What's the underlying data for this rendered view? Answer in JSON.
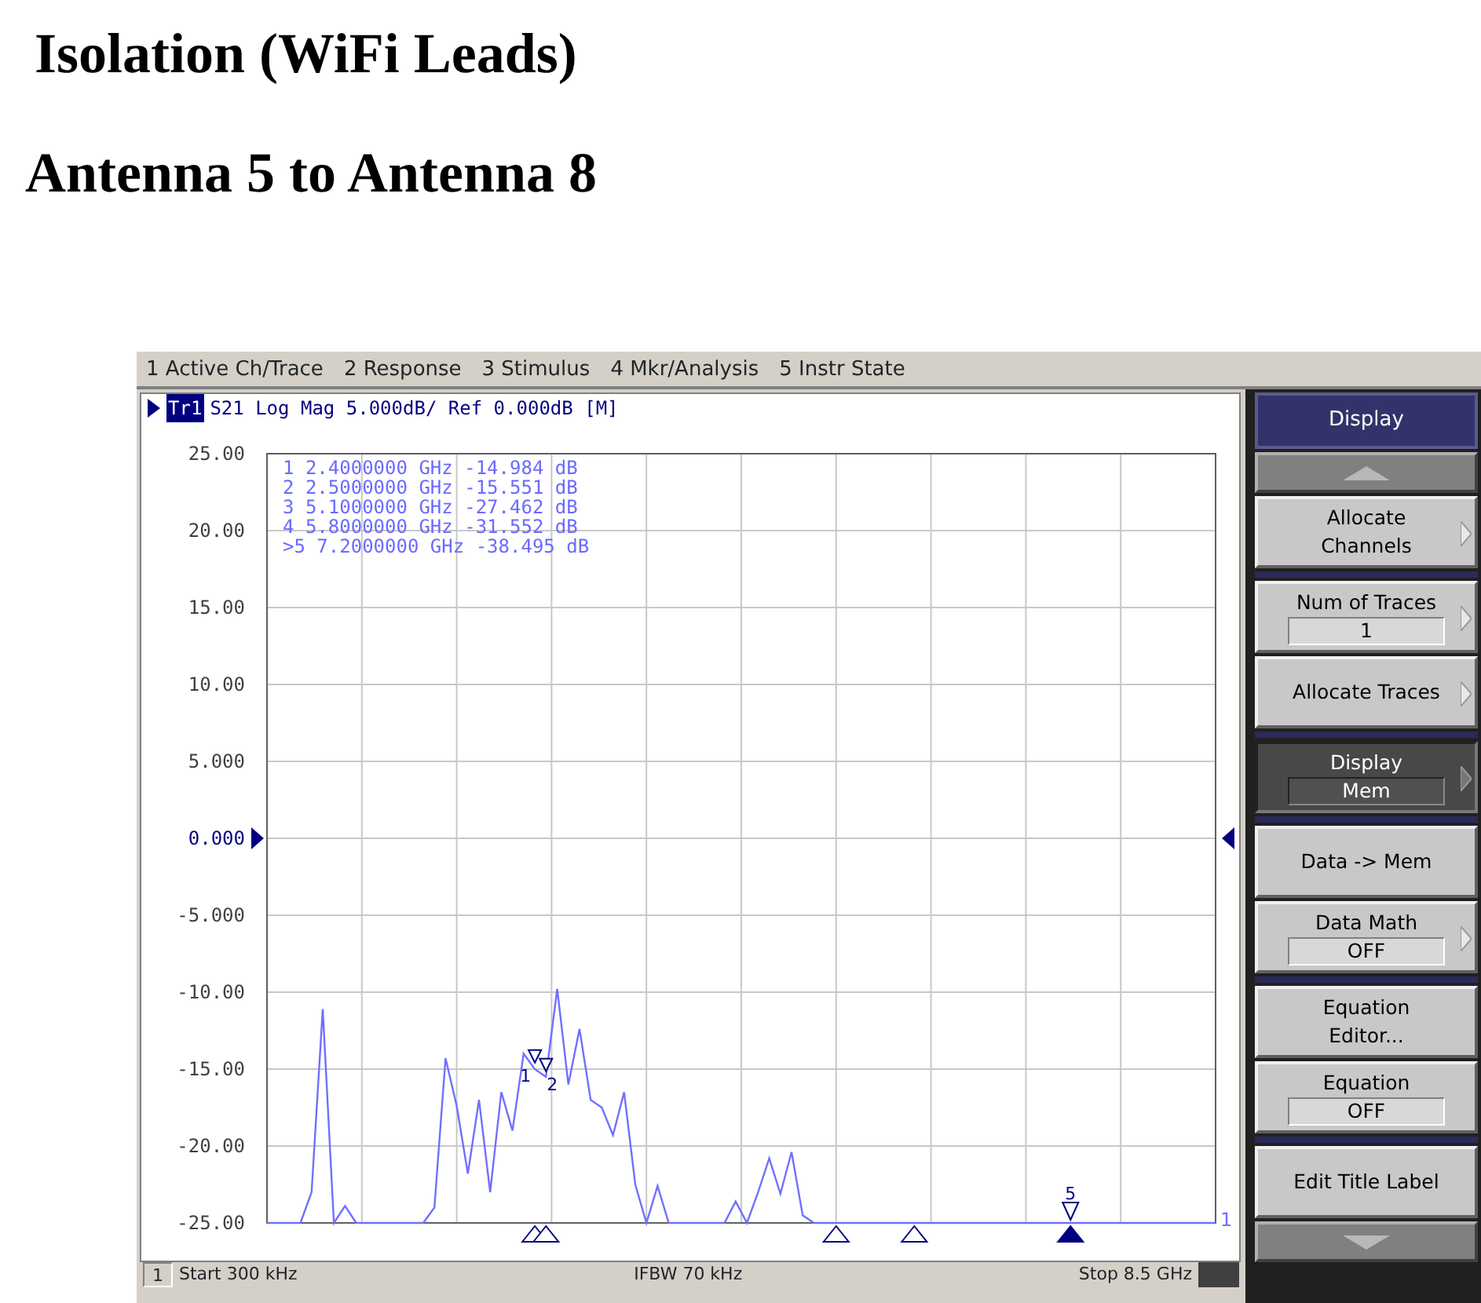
{
  "headings": [
    "Isolation (WiFi Leads)",
    "Antenna 5 to Antenna 8"
  ],
  "analyzer": {
    "menu": [
      "1 Active Ch/Trace",
      "2 Response",
      "3 Stimulus",
      "4 Mkr/Analysis",
      "5 Instr State"
    ],
    "trace_header": {
      "selected": true,
      "text": "S21 Log Mag 5.000dB/ Ref 0.000dB [M]"
    },
    "marker_readout": [
      {
        "index": "1",
        "frequency": "2.4000000 GHz",
        "value": "-14.984 dB"
      },
      {
        "index": "2",
        "frequency": "2.5000000 GHz",
        "value": "-15.551 dB"
      },
      {
        "index": "3",
        "frequency": "5.1000000 GHz",
        "value": "-27.462 dB"
      },
      {
        "index": "4",
        "frequency": "5.8000000 GHz",
        "value": "-31.552 dB"
      },
      {
        "index": ">5",
        "frequency": "7.2000000 GHz",
        "value": "-38.495 dB"
      }
    ],
    "trace_end_label": "1",
    "reference_markers_shown": true,
    "trace_markers": [
      {
        "label": "1",
        "selected": false
      },
      {
        "label": "2",
        "selected": false
      },
      {
        "selected": false
      },
      {
        "selected": false
      },
      {
        "label": "5",
        "selected": true
      }
    ],
    "chart_data": {
      "type": "line",
      "ylim": [
        -25,
        25
      ],
      "yticks": [
        {
          "value": 25,
          "label": "25.00"
        },
        {
          "value": 20,
          "label": "20.00"
        },
        {
          "value": 15,
          "label": "15.00"
        },
        {
          "value": 10,
          "label": "10.00"
        },
        {
          "value": 5,
          "label": "5.000"
        },
        {
          "value": 0,
          "label": "0.000"
        },
        {
          "value": -5,
          "label": "-5.000"
        },
        {
          "value": -10,
          "label": "-10.00"
        },
        {
          "value": -15,
          "label": "-15.00"
        },
        {
          "value": -20,
          "label": "-20.00"
        },
        {
          "value": -25,
          "label": "-25.00"
        }
      ],
      "grid": true,
      "categories": [
        null,
        null,
        null,
        null,
        null,
        null,
        null,
        null,
        null,
        null,
        null,
        null,
        null,
        null,
        null,
        null,
        null,
        null,
        null,
        null,
        null,
        null,
        null,
        null,
        null,
        null,
        null,
        null,
        null,
        null,
        null,
        null,
        null,
        null,
        null,
        null,
        null,
        null,
        null,
        null,
        null,
        null,
        null,
        null,
        null,
        null,
        null,
        null,
        null,
        null,
        null,
        null,
        null,
        null,
        null,
        null,
        null,
        null,
        null,
        null,
        null,
        null,
        null,
        null,
        null,
        null,
        null,
        null,
        null,
        null,
        null,
        null,
        null,
        null,
        null,
        null,
        null,
        null,
        null,
        null,
        null,
        null,
        null,
        null,
        null,
        null
      ],
      "series": [
        {
          "name": "Tr1",
          "color": "#7070ff",
          "values": [
            -25,
            -25,
            -25,
            -25,
            -23,
            -11.1,
            -25,
            -23.9,
            -25,
            -25,
            -25,
            -25,
            -25,
            -25,
            -25,
            -24,
            -14.3,
            -17.4,
            -21.8,
            -17.0,
            -23,
            -16.5,
            -19,
            -14.0,
            -15.0,
            -15.5,
            -9.8,
            -16,
            -12.4,
            -17,
            -17.5,
            -19.3,
            -16.5,
            -22.5,
            -25,
            -22.6,
            -25,
            -25,
            -25,
            -25,
            -25,
            -25,
            -23.6,
            -25,
            -23,
            -20.8,
            -23.1,
            -20.4,
            -24.5,
            -25,
            -25,
            -25,
            -25,
            -25,
            -25,
            -25,
            -25,
            -25,
            -25,
            -25,
            -25,
            -25,
            -25,
            -25,
            -25,
            -25,
            -25,
            -25,
            -25,
            -25,
            -25,
            -25,
            -25,
            -25,
            -25,
            -25,
            -25,
            -25,
            -25,
            -25,
            -25,
            -25,
            -25,
            -25,
            -25,
            -25
          ]
        }
      ]
    },
    "status_bar": {
      "channel": "1",
      "start": "Start 300 kHz",
      "ifbw": "IFBW 70 kHz",
      "stop": "Stop 8.5 GHz"
    },
    "softkeys": {
      "title": "Display",
      "keys": [
        {
          "kind": "scroll-up"
        },
        {
          "kind": "key",
          "label": "Allocate Channels",
          "submenu": true,
          "pressed": false,
          "group_start": false
        },
        {
          "kind": "key",
          "label": "Num of Traces",
          "value": "1",
          "submenu": true,
          "pressed": false,
          "group_start": true
        },
        {
          "kind": "key",
          "label": "Allocate Traces",
          "submenu": true,
          "pressed": false,
          "group_start": false
        },
        {
          "kind": "key",
          "label": "Display",
          "value": "Mem",
          "submenu": true,
          "pressed": true,
          "group_start": true
        },
        {
          "kind": "key",
          "label": "Data -> Mem",
          "submenu": false,
          "pressed": false,
          "group_start": true
        },
        {
          "kind": "key",
          "label": "Data Math",
          "value": "OFF",
          "submenu": true,
          "pressed": false,
          "group_start": false
        },
        {
          "kind": "key",
          "label": "Equation Editor...",
          "submenu": false,
          "pressed": false,
          "group_start": true
        },
        {
          "kind": "key",
          "label": "Equation",
          "value": "OFF",
          "submenu": false,
          "pressed": false,
          "group_start": false
        },
        {
          "kind": "key",
          "label": "Edit Title Label",
          "submenu": false,
          "pressed": false,
          "group_start": true
        },
        {
          "kind": "scroll-down"
        }
      ]
    }
  }
}
